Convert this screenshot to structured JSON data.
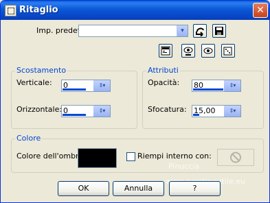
{
  "window": {
    "title": "Ritaglio",
    "close_glyph": "✕"
  },
  "preset": {
    "label": "Imp. predef.:",
    "value": "",
    "arrow_glyph": "▾"
  },
  "toolbar_icons": [
    "save-preset-icon",
    "save-disk-icon",
    "randomize-icon",
    "preview-eye-icon",
    "reset-eye-icon",
    "dice-icon"
  ],
  "scostamento": {
    "title": "Scostamento",
    "vertical": {
      "label": "Verticale:",
      "value": "0",
      "level": 0.5
    },
    "horizontal": {
      "label": "Orizzontale:",
      "value": "0",
      "level": 0.5
    }
  },
  "attributi": {
    "title": "Attributi",
    "opacity": {
      "label": "Opacità:",
      "value": "80",
      "level": 0.8
    },
    "blur": {
      "label": "Sfocatura:",
      "value": "15,00",
      "level": 0.15
    }
  },
  "colore": {
    "title": "Colore",
    "shadow_label": "Colore dell'ombra:",
    "shadow_color": "#000000",
    "fill_label": "Riempi interno con:",
    "fill_checked": false
  },
  "buttons": {
    "ok": "OK",
    "cancel": "Annulla",
    "help": "?"
  },
  "watermark": {
    "line1": "Pinuccia",
    "line2": "www.paintingutile.eu"
  }
}
